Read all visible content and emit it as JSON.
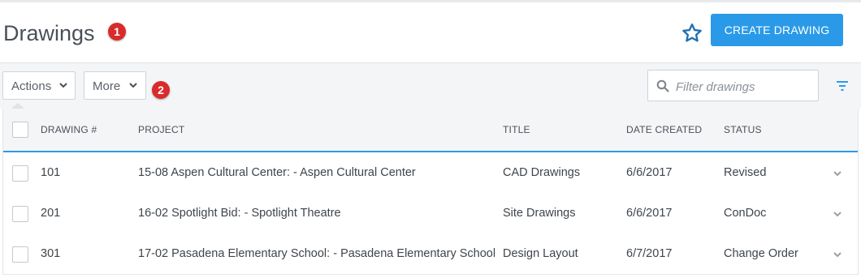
{
  "header": {
    "title": "Drawings",
    "badge_1": "1",
    "create_button": "CREATE DRAWING"
  },
  "toolbar": {
    "actions_label": "Actions",
    "more_label": "More",
    "badge_2": "2",
    "filter_placeholder": "Filter drawings"
  },
  "table": {
    "columns": [
      "DRAWING #",
      "PROJECT",
      "TITLE",
      "DATE CREATED",
      "STATUS"
    ],
    "rows": [
      {
        "number": "101",
        "project": "15-08 Aspen Cultural Center: - Aspen Cultural Center",
        "title": "CAD Drawings",
        "date": "6/6/2017",
        "status": "Revised"
      },
      {
        "number": "201",
        "project": "16-02 Spotlight Bid: - Spotlight Theatre",
        "title": "Site Drawings",
        "date": "6/6/2017",
        "status": "ConDoc"
      },
      {
        "number": "301",
        "project": "17-02 Pasadena Elementary School: - Pasadena Elementary School",
        "title": "Design Layout",
        "date": "6/7/2017",
        "status": "Change Order"
      }
    ]
  },
  "icons": {
    "favorite": "star-outline-icon",
    "filter_search": "search-icon",
    "advanced_filter": "filter-funnel-icon",
    "dropdown": "chevron-down-icon"
  },
  "colors": {
    "primary": "#2a9ae8",
    "badge": "#d92b2b",
    "star": "#1f6fb2"
  }
}
